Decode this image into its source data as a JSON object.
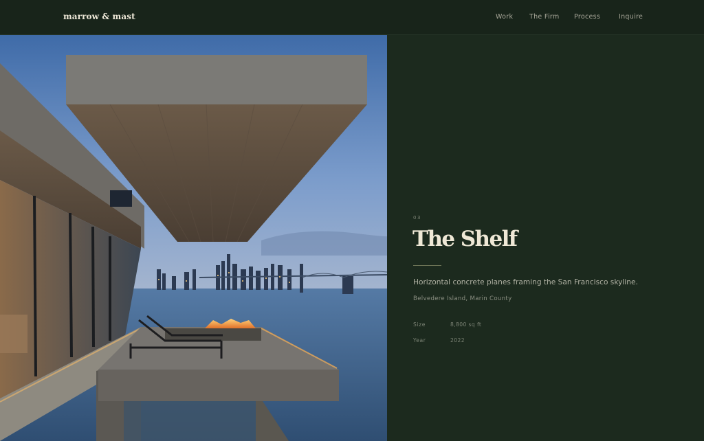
{
  "brand": {
    "logo": "marrow & mast"
  },
  "nav": {
    "items": [
      {
        "label": "Work"
      },
      {
        "label": "The Firm"
      },
      {
        "label": "Process"
      },
      {
        "label": "Inquire"
      }
    ]
  },
  "project": {
    "number": "03",
    "title": "The Shelf",
    "description": "Horizontal concrete planes framing the San Francisco skyline.",
    "location": "Belvedere Island, Marin County",
    "meta": [
      {
        "label": "Size",
        "value": "8,800 sq ft"
      },
      {
        "label": "Year",
        "value": "2022"
      }
    ]
  },
  "colors": {
    "background": "#1c2a1e",
    "topbar": "#18241a",
    "title": "#efe8d6",
    "text": "#b1b2a4",
    "muted": "#7d8476"
  }
}
